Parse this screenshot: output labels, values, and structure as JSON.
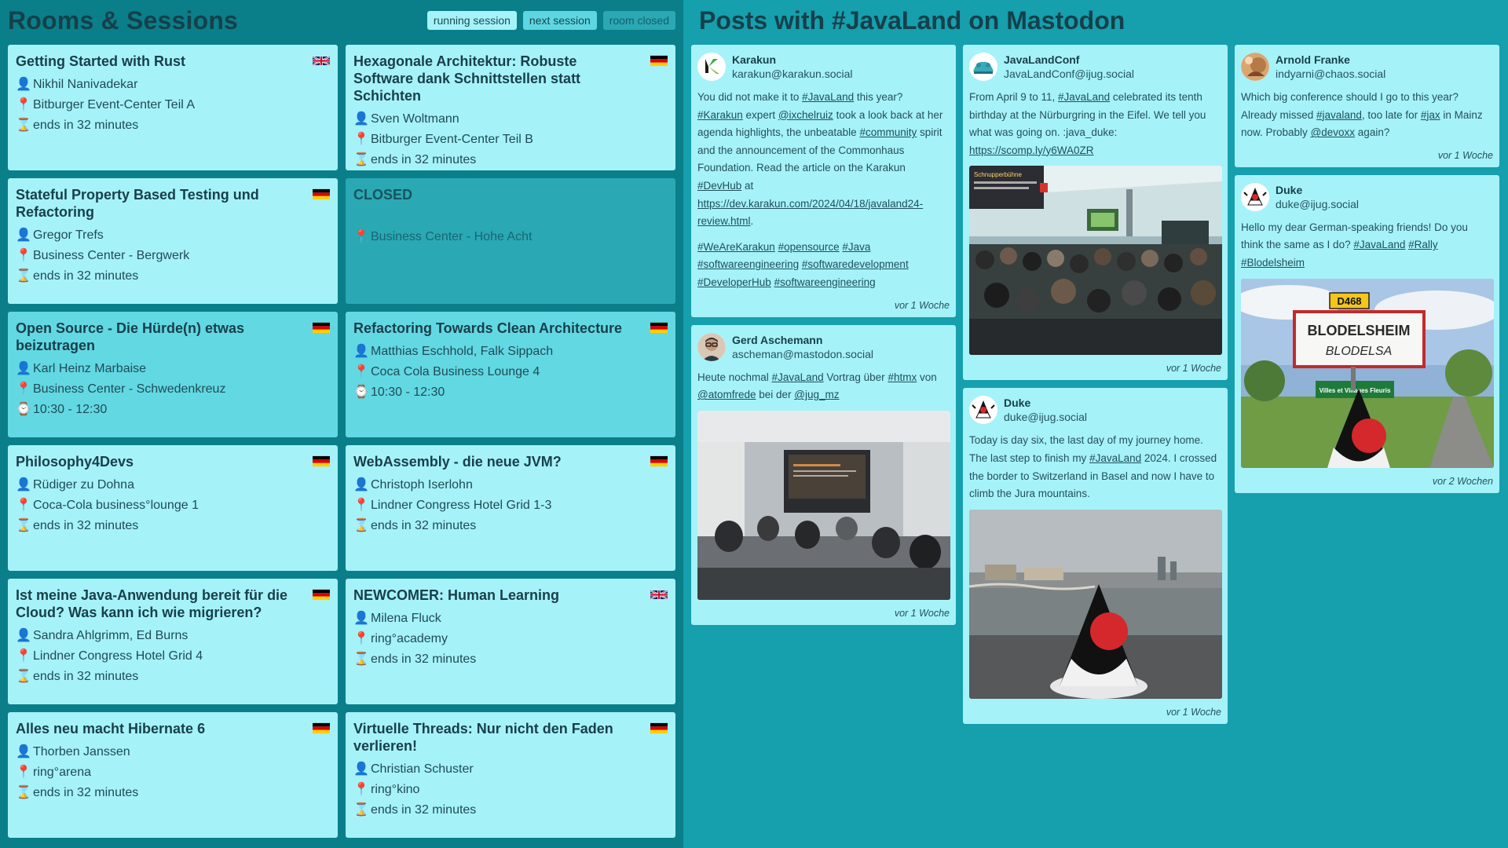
{
  "left": {
    "title": "Rooms & Sessions",
    "legend": {
      "running": "running session",
      "next": "next session",
      "closed": "room closed"
    }
  },
  "sessions": [
    {
      "title": "Getting Started with Rust",
      "speaker": "Nikhil Nanivadekar",
      "room": "Bitburger Event-Center Teil A",
      "time": "ends in 32 minutes",
      "lang": "uk-flag"
    },
    {
      "title": "Hexagonale Architektur: Robuste Software dank Schnittstellen statt Schichten",
      "speaker": "Sven Woltmann",
      "room": "Bitburger Event-Center Teil B",
      "time": "ends in 32 minutes",
      "lang": "de-flag"
    },
    {
      "title": "Stateful Property Based Testing und Refactoring",
      "speaker": "Gregor Trefs",
      "room": "Business Center - Bergwerk",
      "time": "ends in 32 minutes",
      "lang": "de-flag"
    },
    {
      "closed_label": "CLOSED",
      "room": "Business Center - Hohe Acht"
    },
    {
      "title": "Open Source - Die Hürde(n) etwas beizutragen",
      "speaker": "Karl Heinz Marbaise",
      "room": "Business Center - Schwedenkreuz",
      "time": "10:30 - 12:30",
      "lang": "de-flag"
    },
    {
      "title": "Refactoring Towards Clean Architecture",
      "speaker": "Matthias Eschhold, Falk Sippach",
      "room": "Coca Cola Business Lounge 4",
      "time": "10:30 - 12:30",
      "lang": "de-flag"
    },
    {
      "title": "Philosophy4Devs",
      "speaker": "Rüdiger zu Dohna",
      "room": "Coca-Cola business°lounge 1",
      "time": "ends in 32 minutes",
      "lang": "de-flag"
    },
    {
      "title": "WebAssembly - die neue JVM?",
      "speaker": "Christoph Iserlohn",
      "room": "Lindner Congress Hotel Grid 1-3",
      "time": "ends in 32 minutes",
      "lang": "de-flag"
    },
    {
      "title": "Ist meine Java-Anwendung bereit für die Cloud? Was kann ich wie migrieren?",
      "speaker": "Sandra Ahlgrimm, Ed Burns",
      "room": "Lindner Congress Hotel Grid 4",
      "time": "ends in 32 minutes",
      "lang": "de-flag"
    },
    {
      "title": "NEWCOMER: Human Learning",
      "speaker": "Milena Fluck",
      "room": "ring°academy",
      "time": "ends in 32 minutes",
      "lang": "uk-flag"
    },
    {
      "title": "Alles neu macht Hibernate 6",
      "speaker": "Thorben Janssen",
      "room": "ring°arena",
      "time": "ends in 32 minutes",
      "lang": "de-flag"
    },
    {
      "title": "Virtuelle Threads: Nur nicht den Faden verlieren!",
      "speaker": "Christian Schuster",
      "room": "ring°kino",
      "time": "ends in 32 minutes",
      "lang": "de-flag"
    }
  ],
  "right": {
    "title": "Posts with #JavaLand on Mastodon"
  },
  "posts": {
    "karakun": {
      "name": "Karakun",
      "handle": "karakun@karakun.social",
      "p1": {
        "t0": "You did not make it to ",
        "l0": "#JavaLand",
        "t1": " this year? ",
        "l1": "#Karakun",
        "t2": " expert ",
        "l2": "@ixchelruiz",
        "t3": " took a look back at her agenda highlights, the unbeatable ",
        "l3": "#community",
        "t4": " spirit and the announcement of the Commonhaus Foundation. Read the article on the Karakun ",
        "l4": "#DevHub",
        "t5": " at ",
        "l5": "https://dev.karakun.com/2024/04/18/javaland24-review.html",
        "t6": "."
      },
      "tags": [
        "#WeAreKarakun",
        "#opensource",
        "#Java",
        "#softwareengineering",
        "#softwaredevelopment",
        "#DeveloperHub",
        "#softwareengineering"
      ],
      "time": "vor 1 Woche"
    },
    "gerd": {
      "name": "Gerd Aschemann",
      "handle": "ascheman@mastodon.social",
      "t0": "Heute nochmal ",
      "l0": "#JavaLand",
      "t1": " Vortrag über ",
      "l1": "#htmx",
      "t2": " von ",
      "l2": "@atomfrede",
      "t3": " bei der ",
      "l3": "@jug_mz",
      "time": "vor 1 Woche"
    },
    "javalandconf": {
      "name": "JavaLandConf",
      "handle": "JavaLandConf@ijug.social",
      "t0": "From April 9 to 11, ",
      "l0": "#JavaLand",
      "t1": " celebrated its tenth birthday at the Nürburgring in the Eifel. We tell you what was going on. :java_duke: ",
      "l1": "https://scomp.ly/y6WA0ZR",
      "image_sign": "Schnupperbühne",
      "time": "vor 1 Woche"
    },
    "duke1": {
      "name": "Duke",
      "handle": "duke@ijug.social",
      "t0": "Today is day six, the last day of my journey home. The last step to finish my ",
      "l0": "#JavaLand",
      "t1": " 2024. I crossed the border to Switzerland in Basel and now I have to climb the Jura mountains.",
      "time": "vor 1 Woche"
    },
    "arnold": {
      "name": "Arnold Franke",
      "handle": "indyarni@chaos.social",
      "t0": "Which big conference should I go to this year? Already missed ",
      "l0": "#javaland",
      "t1": ", too late for ",
      "l1": "#jax",
      "t2": " in Mainz now. Probably ",
      "l2": "@devoxx",
      "t3": " again?",
      "time": "vor 1 Woche"
    },
    "duke2": {
      "name": "Duke",
      "handle": "duke@ijug.social",
      "t0": "Hello my dear German-speaking friends! Do you think the same as I do? ",
      "l0": "#JavaLand",
      "t1": " ",
      "l1": "#Rally",
      "t2": " ",
      "l2": "#Blodelsheim",
      "sign_road": "D468",
      "sign_town": "BLODELSHEIM",
      "sign_town2": "BLODELSA",
      "sign_flowers": "Villes et Villages Fleuris",
      "time": "vor 2 Wochen"
    }
  },
  "colors": {
    "running": "#a6f2f9",
    "next": "#62d8e3",
    "closed": "#2aa8b4",
    "left_bg": "#0a7f8a",
    "right_bg": "#169fad"
  }
}
